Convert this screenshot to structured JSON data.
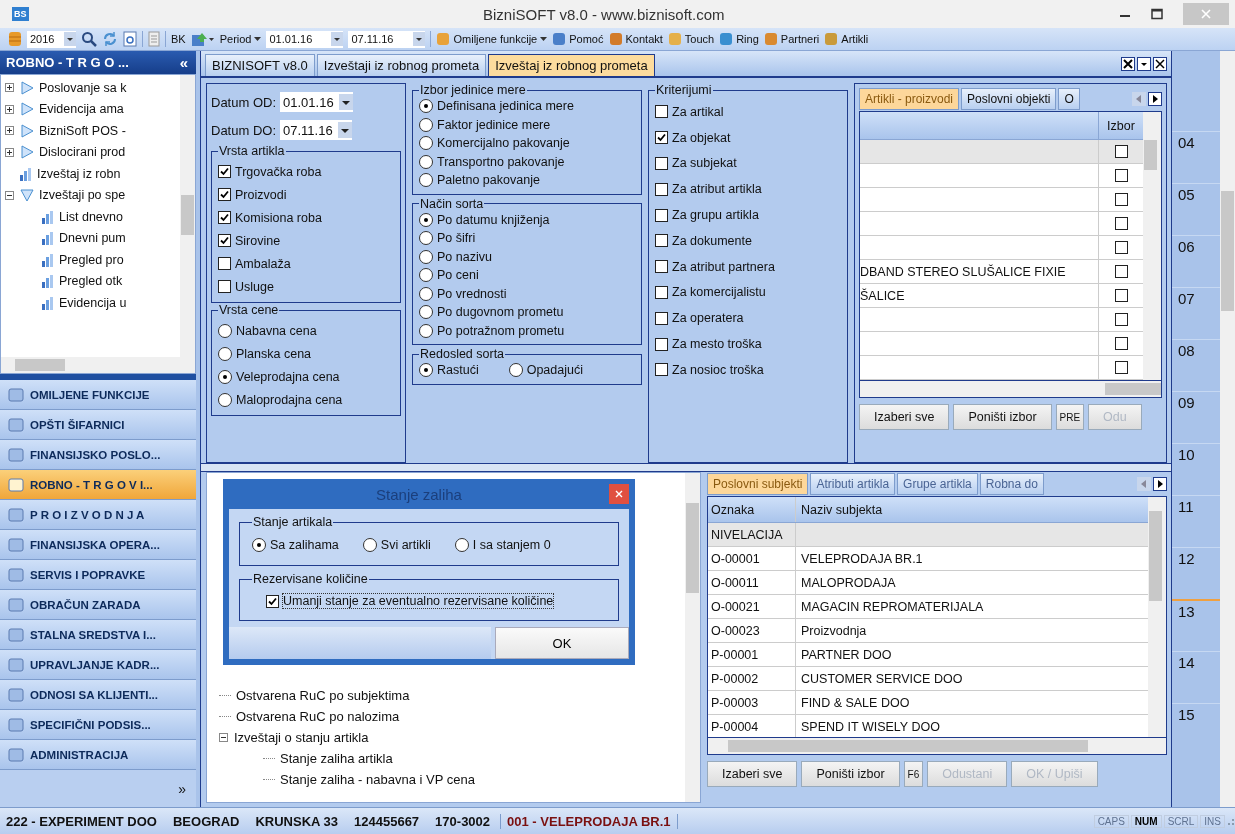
{
  "window": {
    "logo": "BS",
    "title": "BizniSOFT v8.0 - www.biznisoft.com"
  },
  "toolbar": {
    "year": "2016",
    "bk": "BK",
    "period": "Period",
    "date_from": "01.01.16",
    "date_to": "07.11.16",
    "buttons": [
      {
        "label": "Omiljene funkcije",
        "dropdown": true
      },
      {
        "label": "Pomoć",
        "dropdown": false
      },
      {
        "label": "Kontakt",
        "dropdown": false
      },
      {
        "label": "Touch",
        "dropdown": false
      },
      {
        "label": "Ring",
        "dropdown": false
      },
      {
        "label": "Partneri",
        "dropdown": false
      },
      {
        "label": "Artikli",
        "dropdown": false
      }
    ]
  },
  "sidebar": {
    "title": "ROBNO - T R G O ...",
    "collapse": "«",
    "tree": [
      {
        "kind": "folder",
        "label": "Poslovanje sa k",
        "expanded": false
      },
      {
        "kind": "folder",
        "label": "Evidencija ama",
        "expanded": false
      },
      {
        "kind": "folder",
        "label": "BizniSoft POS -",
        "expanded": false
      },
      {
        "kind": "folder",
        "label": "Dislocirani prod",
        "expanded": false
      },
      {
        "kind": "report",
        "label": "Izveštaj iz robn"
      },
      {
        "kind": "folder",
        "label": "Izveštaji po spe",
        "expanded": true,
        "children": [
          {
            "kind": "report",
            "label": "List dnevno"
          },
          {
            "kind": "report",
            "label": "Dnevni pum"
          },
          {
            "kind": "report",
            "label": "Pregled pro"
          },
          {
            "kind": "report",
            "label": "Pregled otk"
          },
          {
            "kind": "report",
            "label": "Evidencija u"
          }
        ]
      }
    ],
    "nav": [
      {
        "label": "OMILJENE FUNKCIJE",
        "selected": false
      },
      {
        "label": "OPŠTI ŠIFARNICI",
        "selected": false
      },
      {
        "label": "FINANSIJSKO POSLO...",
        "selected": false
      },
      {
        "label": "ROBNO - T R G O V I...",
        "selected": true
      },
      {
        "label": "P R O I Z V O D N J A",
        "selected": false
      },
      {
        "label": "FINANSIJSKA OPERA...",
        "selected": false
      },
      {
        "label": "SERVIS I POPRAVKE",
        "selected": false
      },
      {
        "label": "OBRAČUN ZARADA",
        "selected": false
      },
      {
        "label": "STALNA SREDSTVA I...",
        "selected": false
      },
      {
        "label": "UPRAVLJANJE KADR...",
        "selected": false
      },
      {
        "label": "ODNOSI SA KLIJENTI...",
        "selected": false
      },
      {
        "label": "SPECIFIČNI PODSIS...",
        "selected": false
      },
      {
        "label": "ADMINISTRACIJA",
        "selected": false
      }
    ],
    "more": "»"
  },
  "tabs": [
    {
      "label": "BIZNISOFT v8.0",
      "selected": false
    },
    {
      "label": "Izveštaji iz robnog prometa",
      "selected": false
    },
    {
      "label": "Izveštaj iz robnog prometa",
      "selected": true
    }
  ],
  "form": {
    "date_from": {
      "label": "Datum OD:",
      "value": "01.01.16"
    },
    "date_to": {
      "label": "Datum DO:",
      "value": "07.11.16"
    },
    "article_types": {
      "title": "Vrsta artikla",
      "items": [
        {
          "label": "Trgovačka roba",
          "checked": true
        },
        {
          "label": "Proizvodi",
          "checked": true
        },
        {
          "label": "Komisiona roba",
          "checked": true
        },
        {
          "label": "Sirovine",
          "checked": true
        },
        {
          "label": "Ambalaža",
          "checked": false
        },
        {
          "label": "Usluge",
          "checked": false
        }
      ]
    },
    "price_types": {
      "title": "Vrsta cene",
      "items": [
        {
          "label": "Nabavna cena",
          "selected": false
        },
        {
          "label": "Planska cena",
          "selected": false
        },
        {
          "label": "Veleprodajna cena",
          "selected": true
        },
        {
          "label": "Maloprodajna cena",
          "selected": false
        }
      ]
    },
    "unit_choice": {
      "title": "Izbor jedinice mere",
      "items": [
        {
          "label": "Definisana jedinica mere",
          "selected": true
        },
        {
          "label": "Faktor jedinice mere",
          "selected": false
        },
        {
          "label": "Komercijalno pakovanje",
          "selected": false
        },
        {
          "label": "Transportno pakovanje",
          "selected": false
        },
        {
          "label": "Paletno pakovanje",
          "selected": false
        }
      ]
    },
    "sort_method": {
      "title": "Način sorta",
      "items": [
        {
          "label": "Po datumu knjiženja",
          "selected": true
        },
        {
          "label": "Po šifri",
          "selected": false
        },
        {
          "label": "Po nazivu",
          "selected": false
        },
        {
          "label": "Po ceni",
          "selected": false
        },
        {
          "label": "Po vrednosti",
          "selected": false
        },
        {
          "label": "Po dugovnom prometu",
          "selected": false
        },
        {
          "label": "Po potražnom prometu",
          "selected": false
        }
      ]
    },
    "sort_order": {
      "title": "Redosled sorta",
      "items": [
        {
          "label": "Rastući",
          "selected": true
        },
        {
          "label": "Opadajući",
          "selected": false
        }
      ]
    },
    "criteria": {
      "title": "Kriterijumi",
      "items": [
        {
          "label": "Za artikal",
          "checked": false
        },
        {
          "label": "Za objekat",
          "checked": true
        },
        {
          "label": "Za subjekat",
          "checked": false
        },
        {
          "label": "Za atribut artikla",
          "checked": false
        },
        {
          "label": "Za grupu artikla",
          "checked": false
        },
        {
          "label": "Za dokumente",
          "checked": false
        },
        {
          "label": "Za atribut partnera",
          "checked": false
        },
        {
          "label": "Za komercijalistu",
          "checked": false
        },
        {
          "label": "Za operatera",
          "checked": false
        },
        {
          "label": "Za mesto troška",
          "checked": false
        },
        {
          "label": "Za nosioc troška",
          "checked": false
        }
      ]
    }
  },
  "upper_grid": {
    "tabs": [
      {
        "label": "Artikli - proizvodi",
        "selected": true
      },
      {
        "label": "Poslovni objekti",
        "selected": false
      },
      {
        "label": "O",
        "selected": false
      }
    ],
    "pick_header": "Izbor",
    "rows": [
      {
        "selected": true,
        "checked": false
      },
      {
        "selected": false,
        "checked": false
      },
      {
        "selected": false,
        "checked": false
      },
      {
        "selected": false,
        "checked": false
      },
      {
        "selected": false,
        "checked": false
      },
      {
        "name": "DBAND STEREO SLUŠALICE FIXIE",
        "selected": false,
        "checked": false
      },
      {
        "name": "ŠALICE",
        "selected": false,
        "checked": false
      },
      {
        "selected": false,
        "checked": false
      },
      {
        "selected": false,
        "checked": false
      },
      {
        "selected": false,
        "checked": false
      }
    ],
    "buttons": [
      {
        "label": "Izaberi sve",
        "disabled": false
      },
      {
        "label": "Poništi izbor",
        "disabled": false
      },
      {
        "label": "PRE",
        "disabled": false
      },
      {
        "label": "Odu",
        "disabled": true
      }
    ]
  },
  "lower_tree": [
    {
      "label": "Ostvarena RuC po subjektima"
    },
    {
      "label": "Ostvarena RuC po nalozima"
    },
    {
      "label": "Izveštaji o stanju artikla",
      "expanded": true,
      "children": [
        {
          "label": "Stanje zaliha artikla"
        },
        {
          "label": "Stanje zaliha - nabavna i VP cena"
        }
      ]
    }
  ],
  "dialog": {
    "title": "Stanje zaliha",
    "stock": {
      "title": "Stanje artikala",
      "items": [
        {
          "label": "Sa zalihama",
          "selected": true
        },
        {
          "label": "Svi artikli",
          "selected": false
        },
        {
          "label": "I sa stanjem 0",
          "selected": false
        }
      ]
    },
    "reserved": {
      "title": "Rezervisane količine",
      "label": "Umanji stanje za eventualno rezervisane količine",
      "checked": true
    },
    "ok": "OK"
  },
  "lower_grid": {
    "tabs": [
      {
        "label": "Poslovni subjekti",
        "selected": true
      },
      {
        "label": "Atributi artikla",
        "selected": false
      },
      {
        "label": "Grupe artikla",
        "selected": false
      },
      {
        "label": "Robna do",
        "selected": false
      }
    ],
    "columns": [
      "Oznaka",
      "Naziv subjekta"
    ],
    "rows": [
      {
        "code": "NIVELACIJA",
        "selected": true
      },
      {
        "code": "O-00001",
        "name": "VELEPRODAJA BR.1",
        "selected": false
      },
      {
        "code": "O-00011",
        "name": "MALOPRODAJA",
        "selected": false
      },
      {
        "code": "O-00021",
        "name": "MAGACIN REPROMATERIJALA",
        "selected": false
      },
      {
        "code": "O-00023",
        "name": "Proizvodnja",
        "selected": false
      },
      {
        "code": "P-00001",
        "name": "PARTNER DOO",
        "selected": false
      },
      {
        "code": "P-00002",
        "name": "CUSTOMER SERVICE DOO",
        "selected": false
      },
      {
        "code": "P-00003",
        "name": "FIND & SALE DOO",
        "selected": false
      },
      {
        "code": "P-00004",
        "name": "SPEND IT WISELY DOO",
        "selected": false
      }
    ],
    "buttons": [
      {
        "label": "Izaberi sve",
        "disabled": false
      },
      {
        "label": "Poništi izbor",
        "disabled": false
      },
      {
        "label": "F6",
        "disabled": false
      },
      {
        "label": "Odustani",
        "disabled": true
      },
      {
        "label": "OK / Upiši",
        "disabled": true
      }
    ]
  },
  "calendar": {
    "hours": [
      "04",
      "05",
      "06",
      "07",
      "08",
      "09",
      "10",
      "11",
      "12",
      "13",
      "14",
      "15"
    ]
  },
  "status_bar": {
    "company": "222 - EXPERIMENT DOO",
    "city": "BEOGRAD",
    "address": "KRUNSKA 33",
    "tax_id": "124455667",
    "account": "170-3002",
    "warehouse": "001 - VELEPRODAJA BR.1",
    "keys": [
      {
        "label": "CAPS",
        "on": false
      },
      {
        "label": "NUM",
        "on": true
      },
      {
        "label": "SCRL",
        "on": false
      },
      {
        "label": "INS",
        "on": false
      }
    ]
  }
}
